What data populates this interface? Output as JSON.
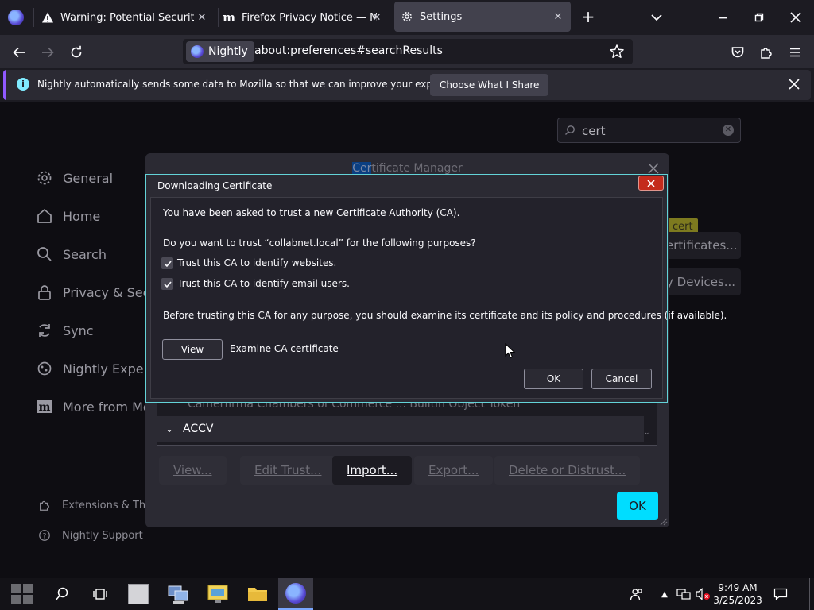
{
  "tabs": [
    {
      "label": "Warning: Potential Security Risk",
      "icon": "warning-icon"
    },
    {
      "label": "Firefox Privacy Notice — Mozilla",
      "icon": "mozilla-m-icon"
    },
    {
      "label": "Settings",
      "icon": "gear-icon",
      "active": true
    }
  ],
  "navbar": {
    "identity_label": "Nightly",
    "url": "about:preferences#searchResults"
  },
  "notification": {
    "text": "Nightly automatically sends some data to Mozilla so that we can improve your experience.",
    "button_label": "Choose What I Share"
  },
  "preferences": {
    "search_value": "cert",
    "categories": [
      {
        "label": "General",
        "icon": "gear-icon"
      },
      {
        "label": "Home",
        "icon": "home-icon"
      },
      {
        "label": "Search",
        "icon": "search-icon"
      },
      {
        "label": "Privacy & Secu",
        "icon": "lock-icon"
      },
      {
        "label": "Sync",
        "icon": "sync-icon"
      },
      {
        "label": "Nightly Experin",
        "icon": "flask-icon"
      },
      {
        "label": "More from Mo",
        "icon": "mozilla-m-icon"
      }
    ],
    "footer_links": [
      {
        "label": "Extensions & The",
        "icon": "puzzle-icon"
      },
      {
        "label": "Nightly Support",
        "icon": "help-icon"
      }
    ],
    "right_frag_1": "ertificates...",
    "right_frag_2": "y Devices...",
    "cert_tag": "cert"
  },
  "cert_manager": {
    "title_hl": "Cer",
    "title_rest": "tificate Manager",
    "list_row_1": "Camerfirma Chambers of Commerce ... Builtin Object Token",
    "list_row_2": "ACCV",
    "buttons": {
      "view": "View...",
      "edit_trust": "Edit Trust...",
      "import": "Import...",
      "export": "Export...",
      "delete": "Delete or Distrust..."
    },
    "ok_label": "OK"
  },
  "download_cert": {
    "title": "Downloading Certificate",
    "intro": "You have been asked to trust a new Certificate Authority (CA).",
    "question": "Do you want to trust “collabnet.local” for the following purposes?",
    "option_websites": "Trust this CA to identify websites.",
    "option_email": "Trust this CA to identify email users.",
    "advice": "Before trusting this CA for any purpose, you should examine its certificate and its policy and procedures (if available).",
    "view_label": "View",
    "examine_label": "Examine CA certificate",
    "ok_label": "OK",
    "cancel_label": "Cancel"
  },
  "taskbar": {
    "time": "9:49 AM",
    "date": "3/25/2023"
  },
  "colors": {
    "accent": "#00ddff",
    "dialog_border": "#63d3d8",
    "close_red": "#c42b1c",
    "highlight_blue": "#0a3f82"
  }
}
